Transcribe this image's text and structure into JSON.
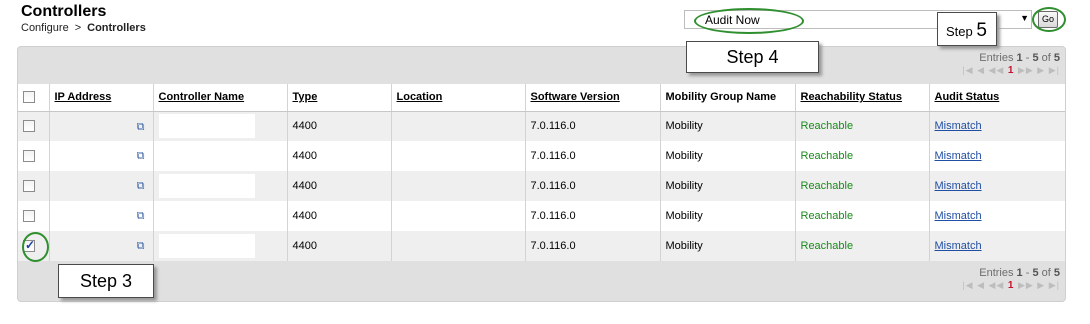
{
  "header": {
    "title": "Controllers",
    "breadcrumb": {
      "parent": "Configure",
      "separator": ">",
      "current": "Controllers"
    }
  },
  "command": {
    "selected": "Audit Now",
    "go_label": "Go"
  },
  "pager": {
    "entries_label": "Entries",
    "range_start": "1",
    "range_sep": " - ",
    "range_end": "5",
    "of_label": " of ",
    "total": "5",
    "current_page": "1"
  },
  "table": {
    "columns": {
      "ip": "IP Address",
      "name": "Controller Name",
      "type": "Type",
      "location": "Location",
      "software": "Software Version",
      "mobility": "Mobility Group Name",
      "reach": "Reachability Status",
      "audit": "Audit Status"
    },
    "rows": [
      {
        "ip": "",
        "name": "",
        "type": "4400",
        "location": "",
        "software": "7.0.116.0",
        "mobility": "Mobility",
        "reach": "Reachable",
        "audit": "Mismatch",
        "checked": false
      },
      {
        "ip": "",
        "name": "",
        "type": "4400",
        "location": "",
        "software": "7.0.116.0",
        "mobility": "Mobility",
        "reach": "Reachable",
        "audit": "Mismatch",
        "checked": false
      },
      {
        "ip": "",
        "name": "",
        "type": "4400",
        "location": "",
        "software": "7.0.116.0",
        "mobility": "Mobility",
        "reach": "Reachable",
        "audit": "Mismatch",
        "checked": false
      },
      {
        "ip": "",
        "name": "",
        "type": "4400",
        "location": "",
        "software": "7.0.116.0",
        "mobility": "Mobility",
        "reach": "Reachable",
        "audit": "Mismatch",
        "checked": false
      },
      {
        "ip": "",
        "name": "",
        "type": "4400",
        "location": "",
        "software": "7.0.116.0",
        "mobility": "Mobility",
        "reach": "Reachable",
        "audit": "Mismatch",
        "checked": true
      }
    ]
  },
  "callouts": {
    "step3": "Step 3",
    "step4": "Step 4",
    "step5_word": "Step",
    "step5_num": "5"
  },
  "colors": {
    "accent_ring": "#2f8f2f",
    "reachable": "#1b8a1b",
    "link": "#1f4ea3",
    "panel": "#e0e0e0"
  },
  "icons": {
    "row_launch": "external-link-icon",
    "select_arrow": "dropdown-arrow-icon"
  }
}
